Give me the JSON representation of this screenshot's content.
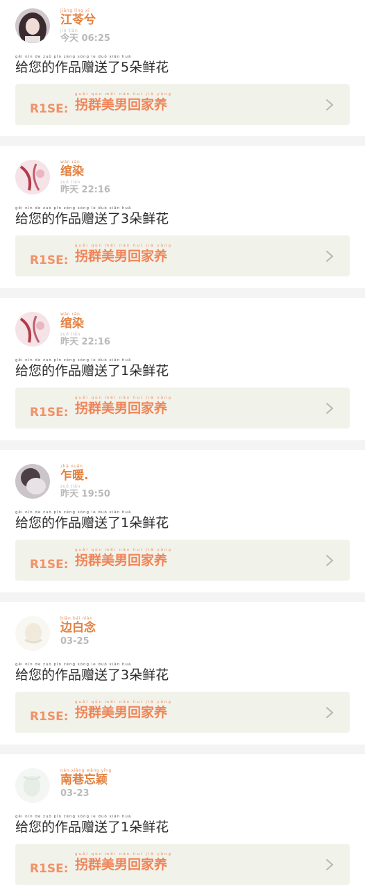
{
  "notifications": [
    {
      "name": "江苓兮",
      "name_pinyin": "jiāng líng xī",
      "time": "今天 06:25",
      "time_pinyin": "jīn tiān",
      "message": "给您的作品赠送了5朵鲜花",
      "message_pinyin": "gěi nín de zuò pǐn zèng sòng le duǒ xiān huā",
      "work_prefix": "R1SE:",
      "work_title": "拐群美男回家养",
      "work_pinyin": "guǎi qún měi nán huí jiā yǎng",
      "avatar_color": "#6b5a62"
    },
    {
      "name": "绾染",
      "name_pinyin": "wǎn rǎn",
      "time": "昨天 22:16",
      "time_pinyin": "zuó tiān",
      "message": "给您的作品赠送了3朵鲜花",
      "message_pinyin": "gěi nín de zuò pǐn zèng sòng le duǒ xiān huā",
      "work_prefix": "R1SE:",
      "work_title": "拐群美男回家养",
      "work_pinyin": "guǎi qún měi nán huí jiā yǎng",
      "avatar_color": "#d9a8b6"
    },
    {
      "name": "绾染",
      "name_pinyin": "wǎn rǎn",
      "time": "昨天 22:16",
      "time_pinyin": "zuó tiān",
      "message": "给您的作品赠送了1朵鲜花",
      "message_pinyin": "gěi nín de zuò pǐn zèng sòng le duǒ xiān huā",
      "work_prefix": "R1SE:",
      "work_title": "拐群美男回家养",
      "work_pinyin": "guǎi qún měi nán huí jiā yǎng",
      "avatar_color": "#d9a8b6"
    },
    {
      "name": "乍暖.",
      "name_pinyin": "zhà nuǎn",
      "time": "昨天 19:50",
      "time_pinyin": "zuó tiān",
      "message": "给您的作品赠送了1朵鲜花",
      "message_pinyin": "gěi nín de zuò pǐn zèng sòng le duǒ xiān huā",
      "work_prefix": "R1SE:",
      "work_title": "拐群美男回家养",
      "work_pinyin": "guǎi qún měi nán huí jiā yǎng",
      "avatar_color": "#b8b2b6"
    },
    {
      "name": "边白念",
      "name_pinyin": "biān bái niàn",
      "time": "03-25",
      "time_pinyin": "",
      "message": "给您的作品赠送了3朵鲜花",
      "message_pinyin": "gěi nín de zuò pǐn zèng sòng le duǒ xiān huā",
      "work_prefix": "R1SE:",
      "work_title": "拐群美男回家养",
      "work_pinyin": "guǎi qún měi nán huí jiā yǎng",
      "avatar_color": "#f3f1ea"
    },
    {
      "name": "南巷忘颖",
      "name_pinyin": "nán xiàng wàng yǐng",
      "time": "03-23",
      "time_pinyin": "",
      "message": "给您的作品赠送了1朵鲜花",
      "message_pinyin": "gěi nín de zuò pǐn zèng sòng le duǒ xiān huā",
      "work_prefix": "R1SE:",
      "work_title": "拐群美男回家养",
      "work_pinyin": "guǎi qún měi nán huí jiā yǎng",
      "avatar_color": "#eef2ee"
    }
  ],
  "icons": {
    "chevron": "chevron-right-icon"
  },
  "colors": {
    "accent": "#e4803f",
    "work_bg": "#f1f2e9",
    "separator": "#f4f4f4"
  }
}
